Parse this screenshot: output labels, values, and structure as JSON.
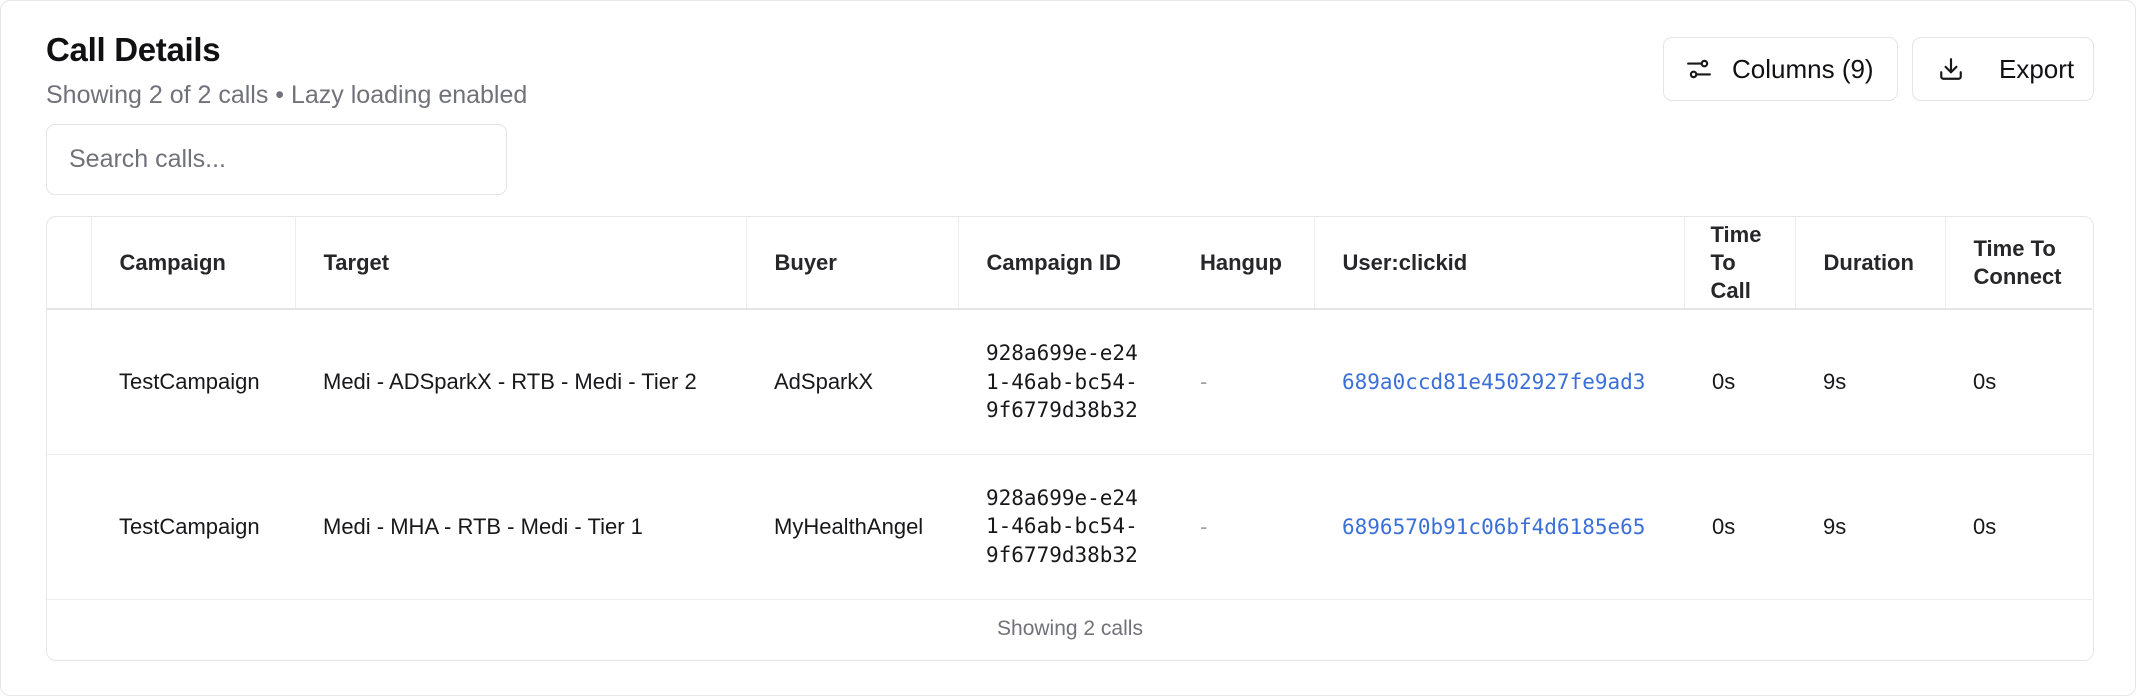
{
  "header": {
    "title": "Call Details",
    "subtitle": "Showing 2 of 2 calls • Lazy loading enabled"
  },
  "search": {
    "placeholder": "Search calls...",
    "value": ""
  },
  "toolbar": {
    "columns_label": "Columns (9)",
    "columns_icon": "sliders-icon",
    "export_label": "Export",
    "export_icon": "download-icon"
  },
  "table": {
    "columns": [
      "",
      "Campaign",
      "Target",
      "Buyer",
      "Campaign ID",
      "Hangup",
      "User:clickid",
      "Time To Call",
      "Duration",
      "Time To Connect"
    ],
    "rows": [
      {
        "campaign": "TestCampaign",
        "target": "Medi - ADSparkX - RTB - Medi - Tier 2",
        "buyer": "AdSparkX",
        "campaign_id": "928a699e-e241-46ab-bc54-9f6779d38b32",
        "hangup": "-",
        "clickid": "689a0ccd81e4502927fe9ad3",
        "time_to_call": "0s",
        "duration": "9s",
        "time_to_connect": "0s"
      },
      {
        "campaign": "TestCampaign",
        "target": "Medi - MHA - RTB - Medi - Tier 1",
        "buyer": "MyHealthAngel",
        "campaign_id": "928a699e-e241-46ab-bc54-9f6779d38b32",
        "hangup": "-",
        "clickid": "6896570b91c06bf4d6185e65",
        "time_to_call": "0s",
        "duration": "9s",
        "time_to_connect": "0s"
      }
    ],
    "footer": "Showing 2 calls"
  },
  "colors": {
    "link": "#3b6fd8",
    "muted_text": "#71717a",
    "border": "#e4e4e7"
  }
}
